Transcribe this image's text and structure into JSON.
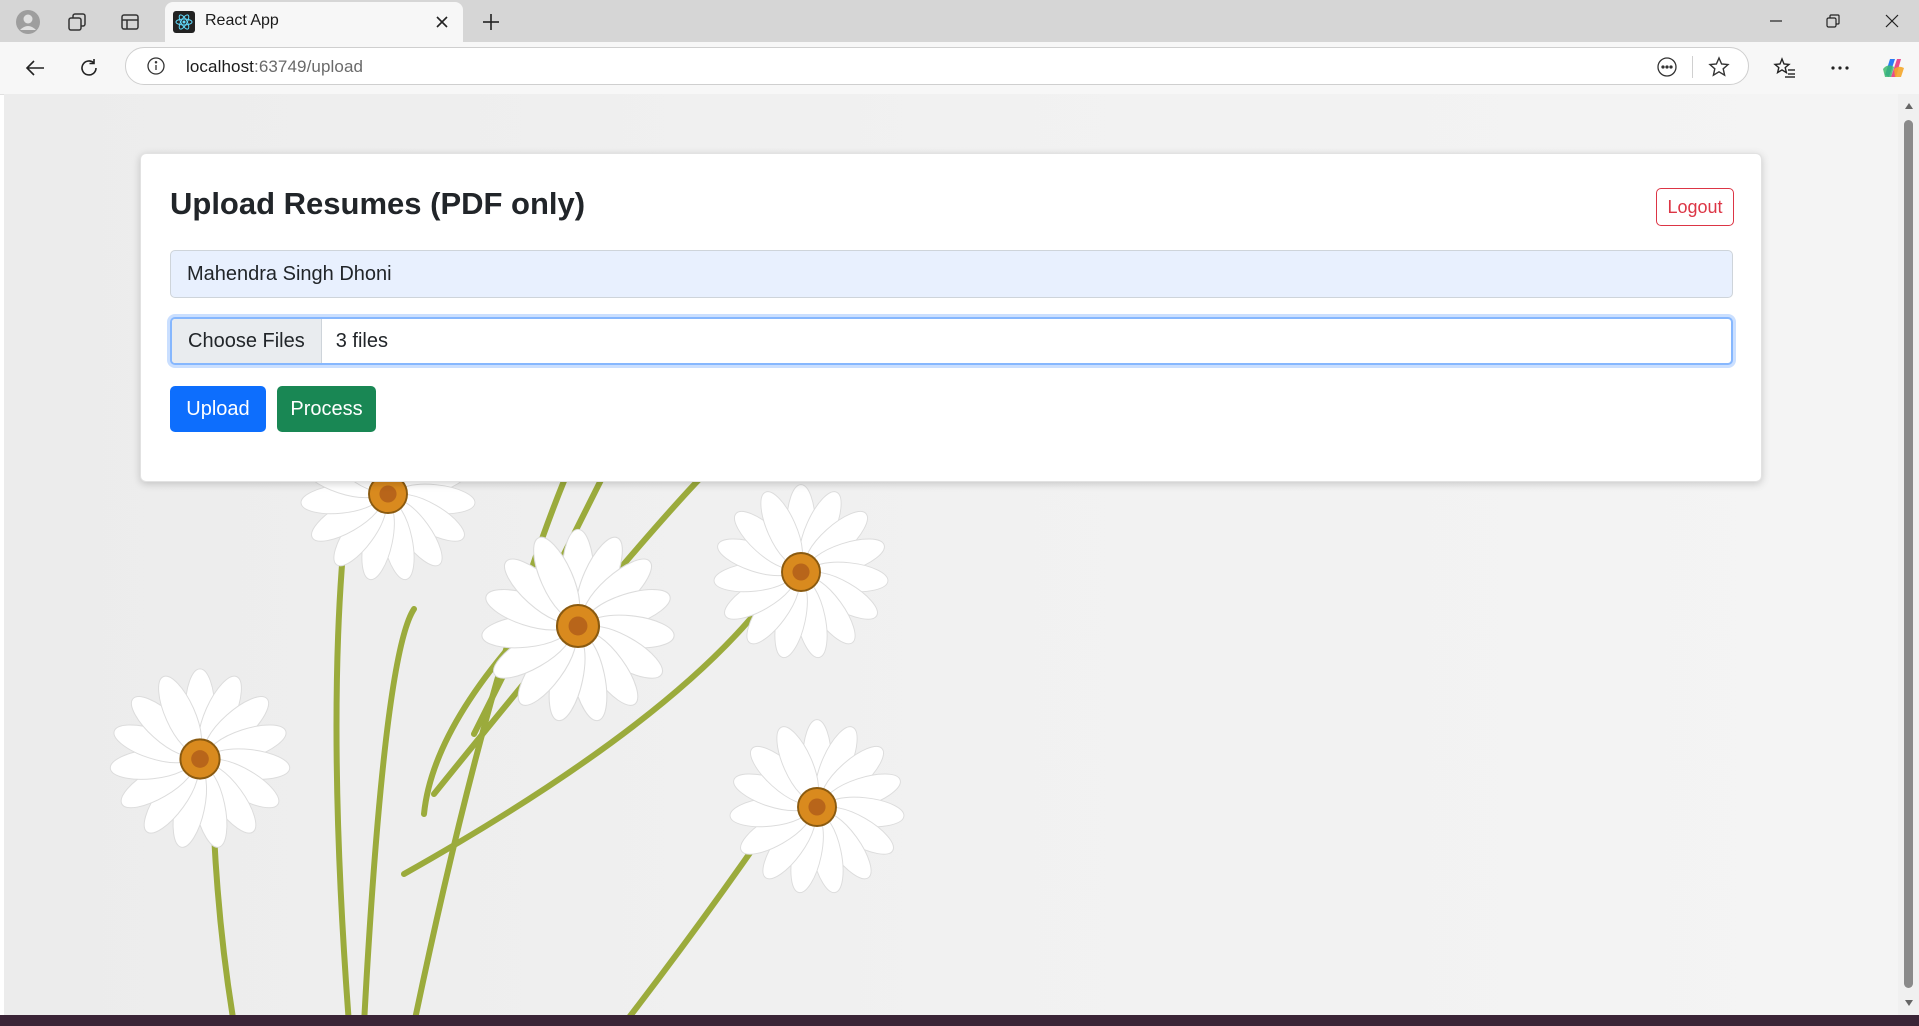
{
  "browser": {
    "tab_title": "React App",
    "url_host": "localhost",
    "url_path": ":63749/upload"
  },
  "icons": {
    "profile": "profile-icon",
    "workspaces": "workspaces-icon",
    "vertical_tabs": "vertical-tabs-icon",
    "favicon": "react-logo-icon",
    "tab_close": "close-icon",
    "new_tab": "plus-icon",
    "minimize": "minimize-icon",
    "restore": "restore-icon",
    "window_close": "close-icon",
    "back": "back-arrow-icon",
    "refresh": "refresh-icon",
    "site_info": "info-icon",
    "read_aloud": "more-options-icon",
    "favorite": "star-icon",
    "favorites": "favorites-icon",
    "menu": "ellipsis-icon",
    "copilot": "copilot-icon"
  },
  "page": {
    "title": "Upload Resumes (PDF only)",
    "logout_label": "Logout",
    "name_value": "Mahendra Singh Dhoni",
    "choose_files_label": "Choose Files",
    "file_status": "3 files",
    "upload_label": "Upload",
    "process_label": "Process"
  },
  "colors": {
    "primary": "#0d6efd",
    "success": "#198754",
    "danger": "#dc3545",
    "autofill": "#e8f0fe"
  }
}
